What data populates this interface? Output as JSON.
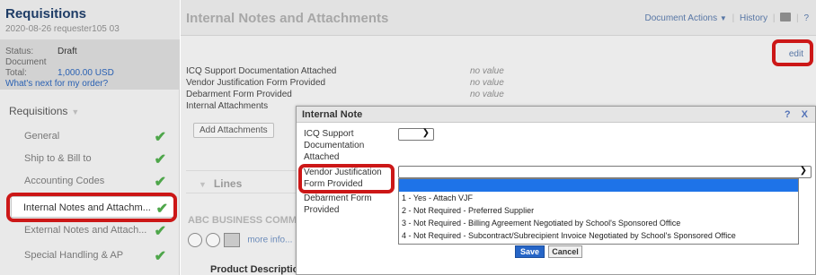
{
  "sidebar": {
    "title": "Requisitions",
    "subtitle": "2020-08-26 requester105 03",
    "status_label": "Status:",
    "status_value": "Draft",
    "total_label": "Document Total:",
    "total_value": "1,000.00 USD",
    "whats_next": "What's next for my order?",
    "section_title": "Requisitions",
    "items": [
      {
        "label": "General"
      },
      {
        "label": "Ship to & Bill to"
      },
      {
        "label": "Accounting Codes"
      },
      {
        "label": "Internal Notes and Attachm..."
      },
      {
        "label": "External Notes and Attach..."
      },
      {
        "label": "Special Handling & AP"
      }
    ],
    "active_index": 3
  },
  "main": {
    "title": "Internal Notes and Attachments",
    "document_actions": "Document Actions",
    "history": "History",
    "edit": "edit",
    "fields": [
      {
        "label": "ICQ Support Documentation Attached",
        "value": "no value"
      },
      {
        "label": "Vendor Justification Form Provided",
        "value": "no value"
      },
      {
        "label": "Debarment Form Provided",
        "value": "no value"
      },
      {
        "label": "Internal Attachments",
        "value": ""
      }
    ],
    "add_attachments": "Add Attachments",
    "lines": "Lines",
    "vendor_name": "ABC BUSINESS COMM",
    "more_info": "more info...",
    "product_description": "Product Description"
  },
  "modal": {
    "title": "Internal Note",
    "help": "?",
    "close": "X",
    "icq_label": "ICQ Support Documentation Attached",
    "vendor_label": "Vendor Justification Form Provided",
    "debarment_label": "Debarment Form Provided",
    "options": [
      "",
      "1 - Yes - Attach VJF",
      "2 - Not Required - Preferred Supplier",
      "3 - Not Required - Billing Agreement Negotiated by School's Sponsored Office",
      "4 - Not Required - Subcontract/Subrecipient Invoice Negotiated by School's Sponsored Office"
    ],
    "save": "Save",
    "cancel": "Cancel"
  },
  "colors": {
    "highlight": "#cc1717",
    "check": "#4ea64a",
    "link": "#2a61b3",
    "selected_option": "#1e73e8"
  }
}
